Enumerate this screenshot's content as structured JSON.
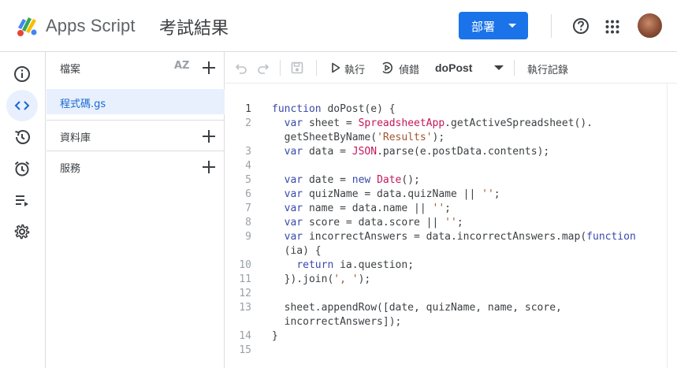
{
  "header": {
    "app_name": "Apps Script",
    "project_title": "考試結果",
    "deploy_label": "部署"
  },
  "rail": {
    "items": [
      {
        "name": "overview-icon"
      },
      {
        "name": "editor-icon"
      },
      {
        "name": "history-icon"
      },
      {
        "name": "triggers-icon"
      },
      {
        "name": "executions-icon"
      },
      {
        "name": "settings-icon"
      }
    ]
  },
  "files": {
    "title": "檔案",
    "sort_label": "AZ",
    "items": [
      {
        "label": "程式碼.gs"
      }
    ],
    "sections": [
      {
        "label": "資料庫"
      },
      {
        "label": "服務"
      }
    ]
  },
  "toolbar": {
    "run_label": "執行",
    "debug_label": "偵錯",
    "function_name": "doPost",
    "log_label": "執行記錄"
  },
  "editor": {
    "lines": [
      {
        "num": "1",
        "text": "function doPost(e) {"
      },
      {
        "num": "2",
        "text": "  var sheet = SpreadsheetApp.getActiveSpreadsheet()."
      },
      {
        "num": "",
        "text": "  getSheetByName('Results');"
      },
      {
        "num": "3",
        "text": "  var data = JSON.parse(e.postData.contents);"
      },
      {
        "num": "4",
        "text": ""
      },
      {
        "num": "5",
        "text": "  var date = new Date();"
      },
      {
        "num": "6",
        "text": "  var quizName = data.quizName || '';"
      },
      {
        "num": "7",
        "text": "  var name = data.name || '';"
      },
      {
        "num": "8",
        "text": "  var score = data.score || '';"
      },
      {
        "num": "9",
        "text": "  var incorrectAnswers = data.incorrectAnswers.map(function"
      },
      {
        "num": "",
        "text": "  (ia) {"
      },
      {
        "num": "10",
        "text": "    return ia.question;"
      },
      {
        "num": "11",
        "text": "  }).join(', ');"
      },
      {
        "num": "12",
        "text": ""
      },
      {
        "num": "13",
        "text": "  sheet.appendRow([date, quizName, name, score,"
      },
      {
        "num": "",
        "text": "  incorrectAnswers]);"
      },
      {
        "num": "14",
        "text": "}"
      },
      {
        "num": "15",
        "text": ""
      }
    ]
  },
  "colors": {
    "accent": "#1a73e8",
    "keyword": "#3949ab",
    "function": "#c2185b",
    "string": "#a1552e",
    "active_bg": "#e8f0fe"
  }
}
